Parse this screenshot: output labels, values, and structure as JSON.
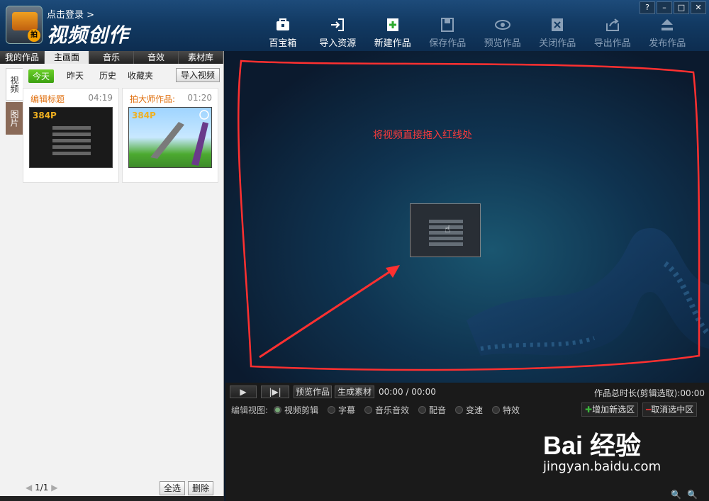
{
  "titlebar": {
    "login_link": "点击登录 >",
    "app_title": "视频创作",
    "badge": "拍",
    "window_controls": [
      "?",
      "–",
      "□",
      "✕"
    ]
  },
  "toolbar": [
    {
      "label": "百宝箱",
      "icon": "toolbox-icon",
      "enabled": true
    },
    {
      "label": "导入资源",
      "icon": "import-icon",
      "enabled": true
    },
    {
      "label": "新建作品",
      "icon": "new-project-icon",
      "enabled": true
    },
    {
      "label": "保存作品",
      "icon": "save-icon",
      "enabled": false
    },
    {
      "label": "预览作品",
      "icon": "eye-icon",
      "enabled": false
    },
    {
      "label": "关闭作品",
      "icon": "close-project-icon",
      "enabled": false
    },
    {
      "label": "导出作品",
      "icon": "export-icon",
      "enabled": false
    },
    {
      "label": "发布作品",
      "icon": "publish-icon",
      "enabled": false
    }
  ],
  "left_panel": {
    "tabs": [
      "我的作品",
      "主画面",
      "音乐",
      "音效",
      "素材库"
    ],
    "active_tab": "主画面",
    "side_tabs": [
      "视频",
      "图片"
    ],
    "filters": [
      "今天",
      "昨天",
      "历史",
      "收藏夹"
    ],
    "active_filter": "今天",
    "import_button": "导入视频",
    "clips": [
      {
        "title": "编辑标题",
        "duration": "04:19",
        "resolution": "384P"
      },
      {
        "title": "拍大师作品:",
        "duration": "01:20",
        "resolution": "384P"
      }
    ],
    "pager": "1/1",
    "select_all": "全选",
    "delete": "删除"
  },
  "stage": {
    "drop_hint": "将视频直接拖入红线处",
    "annotation_color": "#ff3030"
  },
  "controls": {
    "play": "▶",
    "step": "|▶|",
    "preview_btn": "预览作品",
    "generate_btn": "生成素材",
    "timecode": "00:00 / 00:00",
    "total_length": "作品总时长(剪辑选取):00:00",
    "edit_view_label": "编辑视图:",
    "views": [
      "视频剪辑",
      "字幕",
      "音乐音效",
      "配音",
      "变速",
      "特效"
    ],
    "selected_view": "视频剪辑",
    "add_region": "增加新选区",
    "cancel_region": "取消选中区"
  },
  "watermark": {
    "brand": "Bai 经验",
    "url": "jingyan.baidu.com"
  }
}
